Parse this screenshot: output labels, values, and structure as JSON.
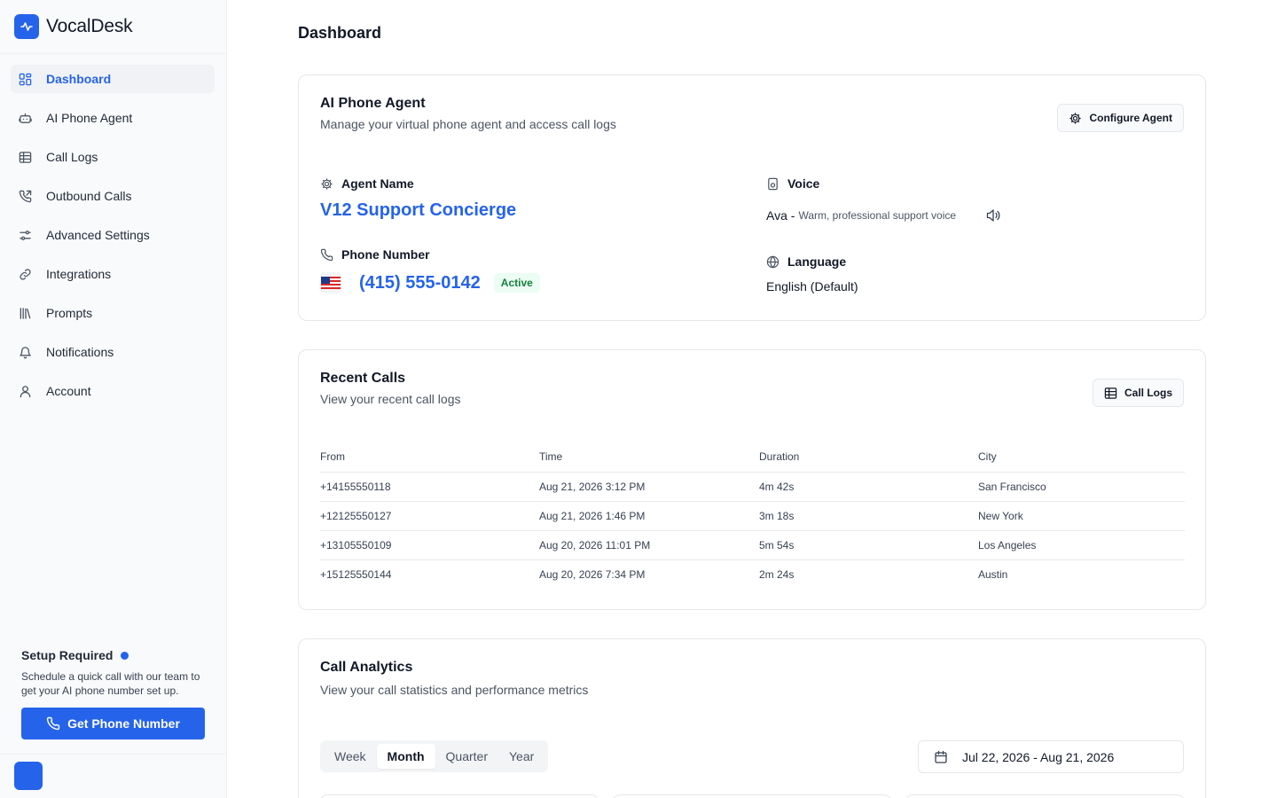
{
  "app": {
    "name": "VocalDesk"
  },
  "sidebar": {
    "items": [
      {
        "label": "Dashboard",
        "icon": "dashboard-icon",
        "active": true
      },
      {
        "label": "AI Phone Agent",
        "icon": "robot-icon"
      },
      {
        "label": "Call Logs",
        "icon": "table-icon"
      },
      {
        "label": "Outbound Calls",
        "icon": "phone-outgoing-icon"
      },
      {
        "label": "Advanced Settings",
        "icon": "sliders-icon"
      },
      {
        "label": "Integrations",
        "icon": "link-icon"
      },
      {
        "label": "Prompts",
        "icon": "library-icon"
      },
      {
        "label": "Notifications",
        "icon": "bell-icon"
      },
      {
        "label": "Account",
        "icon": "user-icon"
      }
    ],
    "setup": {
      "title": "Setup Required",
      "text": "Schedule a quick call with our team to get your AI phone number set up.",
      "button": "Get Phone Number"
    }
  },
  "page": {
    "title": "Dashboard"
  },
  "agent_card": {
    "title": "AI Phone Agent",
    "subtitle": "Manage your virtual phone agent and access call logs",
    "configure_button": "Configure Agent",
    "agent_name_label": "Agent Name",
    "agent_name": "V12 Support Concierge",
    "phone_label": "Phone Number",
    "phone_number": "(415) 555-0142",
    "phone_status": "Active",
    "voice_label": "Voice",
    "voice_name": "Ava -",
    "voice_description": "Warm, professional support voice",
    "language_label": "Language",
    "language_value": "English (Default)"
  },
  "recent_calls": {
    "title": "Recent Calls",
    "subtitle": "View your recent call logs",
    "button": "Call Logs",
    "columns": [
      "From",
      "Time",
      "Duration",
      "City"
    ],
    "rows": [
      [
        "+14155550118",
        "Aug 21, 2026 3:12 PM",
        "4m 42s",
        "San Francisco"
      ],
      [
        "+12125550127",
        "Aug 21, 2026 1:46 PM",
        "3m 18s",
        "New York"
      ],
      [
        "+13105550109",
        "Aug 20, 2026 11:01 PM",
        "5m 54s",
        "Los Angeles"
      ],
      [
        "+15125550144",
        "Aug 20, 2026 7:34 PM",
        "2m 24s",
        "Austin"
      ]
    ]
  },
  "analytics": {
    "title": "Call Analytics",
    "subtitle": "View your call statistics and performance metrics",
    "periods": [
      "Week",
      "Month",
      "Quarter",
      "Year"
    ],
    "selected_period": "Month",
    "date_range": "Jul 22, 2026 - Aug 21, 2026"
  },
  "colors": {
    "accent": "#2563eb",
    "success": "#15803d"
  }
}
